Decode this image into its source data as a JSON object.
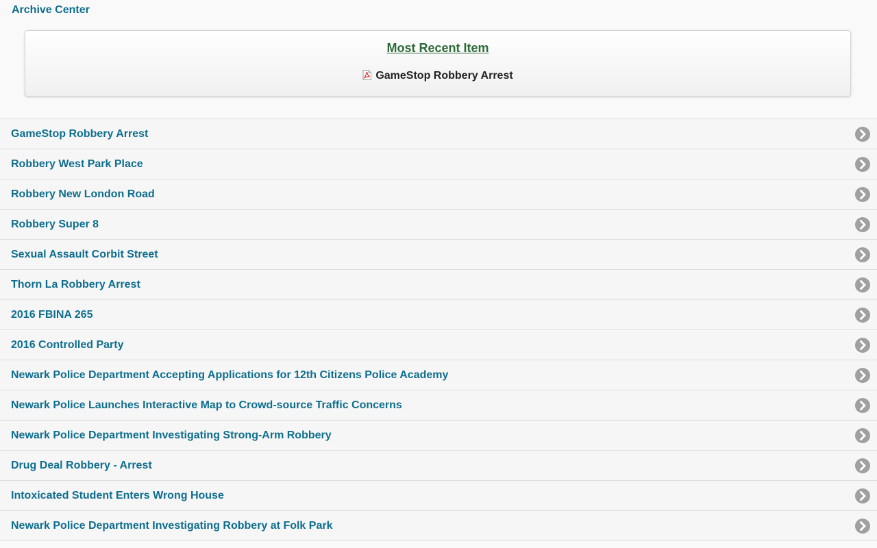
{
  "header": {
    "title": "Archive Center"
  },
  "recent": {
    "heading": "Most Recent Item",
    "item_label": "GameStop Robbery Arrest",
    "item_icon": "pdf-icon"
  },
  "list": {
    "items": [
      {
        "label": "GameStop Robbery Arrest"
      },
      {
        "label": "Robbery West Park Place"
      },
      {
        "label": "Robbery New London Road"
      },
      {
        "label": "Robbery Super 8"
      },
      {
        "label": "Sexual Assault Corbit Street"
      },
      {
        "label": "Thorn La Robbery Arrest"
      },
      {
        "label": "2016 FBINA 265"
      },
      {
        "label": "2016 Controlled Party"
      },
      {
        "label": "Newark Police Department Accepting Applications for 12th Citizens Police Academy"
      },
      {
        "label": "Newark Police Launches Interactive Map to Crowd-source Traffic Concerns"
      },
      {
        "label": "Newark Police Department Investigating Strong-Arm Robbery"
      },
      {
        "label": "Drug Deal Robbery - Arrest"
      },
      {
        "label": "Intoxicated Student Enters Wrong House"
      },
      {
        "label": "Newark Police Department Investigating Robbery at Folk Park"
      }
    ],
    "item_icon": "chevron-right-circle-icon"
  },
  "colors": {
    "link": "#0e6e8e",
    "heading": "#2d6b37",
    "chevron": "#a0a0a0"
  }
}
